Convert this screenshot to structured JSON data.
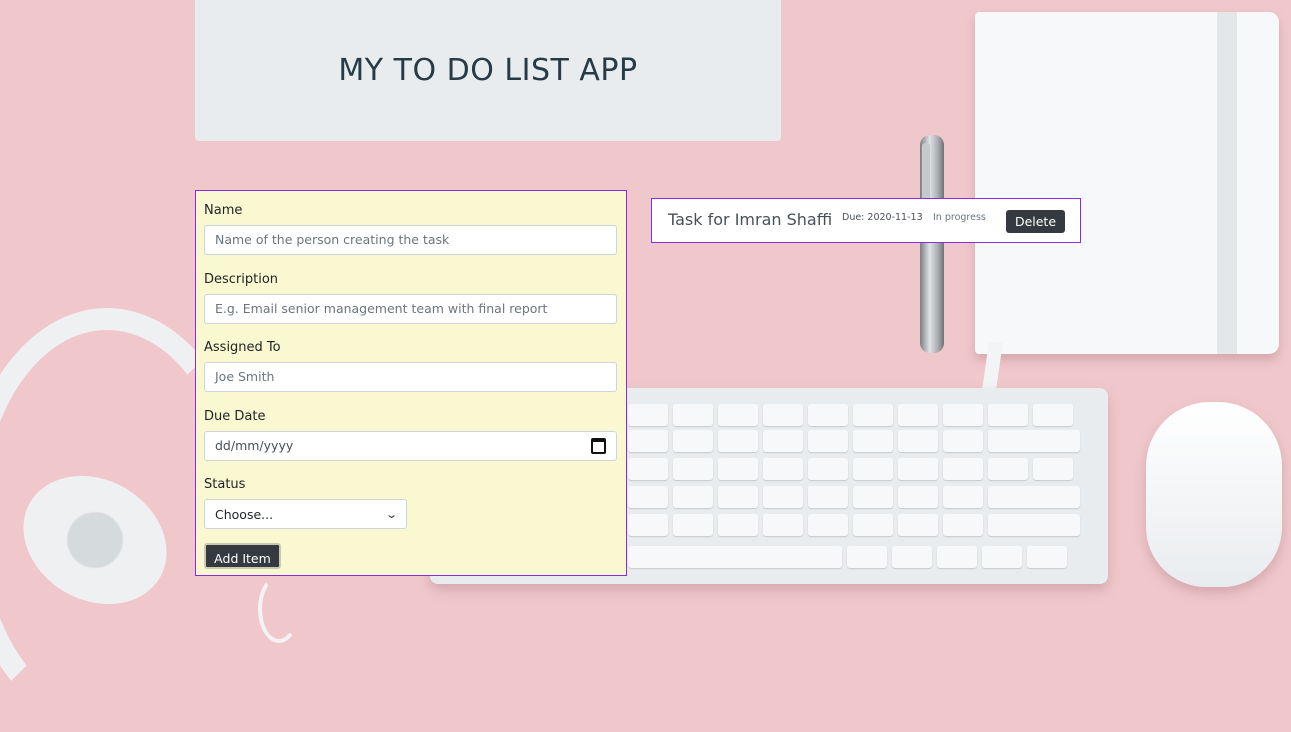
{
  "header": {
    "title": "MY TO DO LIST APP"
  },
  "form": {
    "name": {
      "label": "Name",
      "placeholder": "Name of the person creating the task"
    },
    "description": {
      "label": "Description",
      "placeholder": "E.g. Email senior management team with final report"
    },
    "assigned_to": {
      "label": "Assigned To",
      "placeholder": "Joe Smith"
    },
    "due_date": {
      "label": "Due Date",
      "placeholder": "dd/mm/yyyy"
    },
    "status": {
      "label": "Status",
      "selected": "Choose..."
    },
    "submit_label": "Add Item"
  },
  "tasks": [
    {
      "title": "Task for Imran Shaffi",
      "due": "Due: 2020-11-13",
      "status": "In progress",
      "delete_label": "Delete"
    }
  ],
  "icons": {
    "date": "calendar-icon",
    "select": "chevron-down-icon"
  },
  "colors": {
    "background": "#f0c8cc",
    "header_bg": "#e9ecef",
    "form_bg": "#f9f8d0",
    "card_border": "#8a2be2",
    "button_dark": "#343a40"
  }
}
